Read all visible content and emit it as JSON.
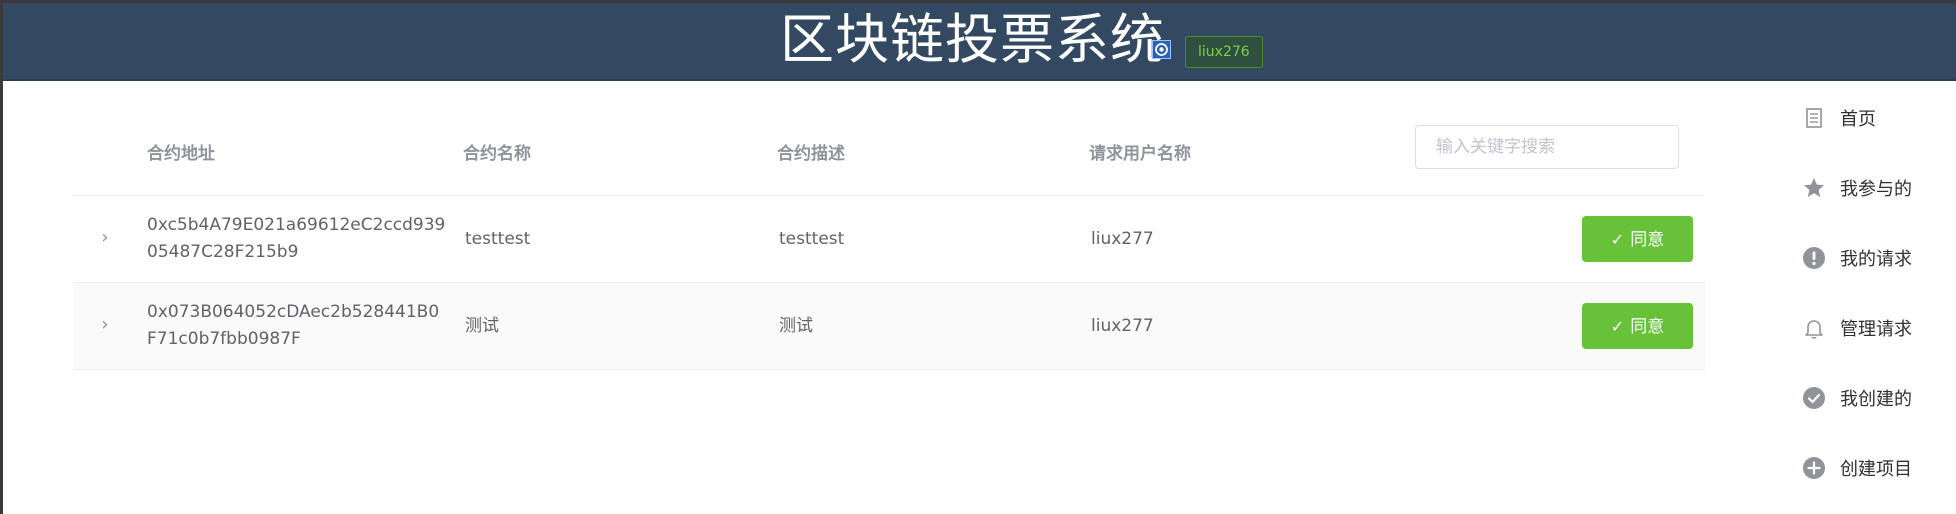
{
  "header": {
    "title": "区块链投票系统",
    "username": "liux276"
  },
  "table": {
    "columns": [
      "合约地址",
      "合约名称",
      "合约描述",
      "请求用户名称"
    ],
    "search_placeholder": "输入关键字搜索",
    "rows": [
      {
        "address": "0xc5b4A79E021a69612eC2ccd93905487C28F215b9",
        "name": "testtest",
        "description": "testtest",
        "user": "liux277",
        "action": "同意"
      },
      {
        "address": "0x073B064052cDAec2b528441B0F71c0b7fbb0987F",
        "name": "测试",
        "description": "测试",
        "user": "liux277",
        "action": "同意"
      }
    ]
  },
  "sidebar": {
    "items": [
      {
        "label": "首页",
        "icon": "document-icon"
      },
      {
        "label": "我参与的",
        "icon": "star-icon"
      },
      {
        "label": "我的请求",
        "icon": "warning-icon"
      },
      {
        "label": "管理请求",
        "icon": "bell-icon"
      },
      {
        "label": "我创建的",
        "icon": "check-circle-icon"
      },
      {
        "label": "创建项目",
        "icon": "plus-circle-icon"
      }
    ]
  },
  "colors": {
    "header_bg": "#334961",
    "success": "#67c23a",
    "text": "#606266",
    "muted": "#909399"
  }
}
